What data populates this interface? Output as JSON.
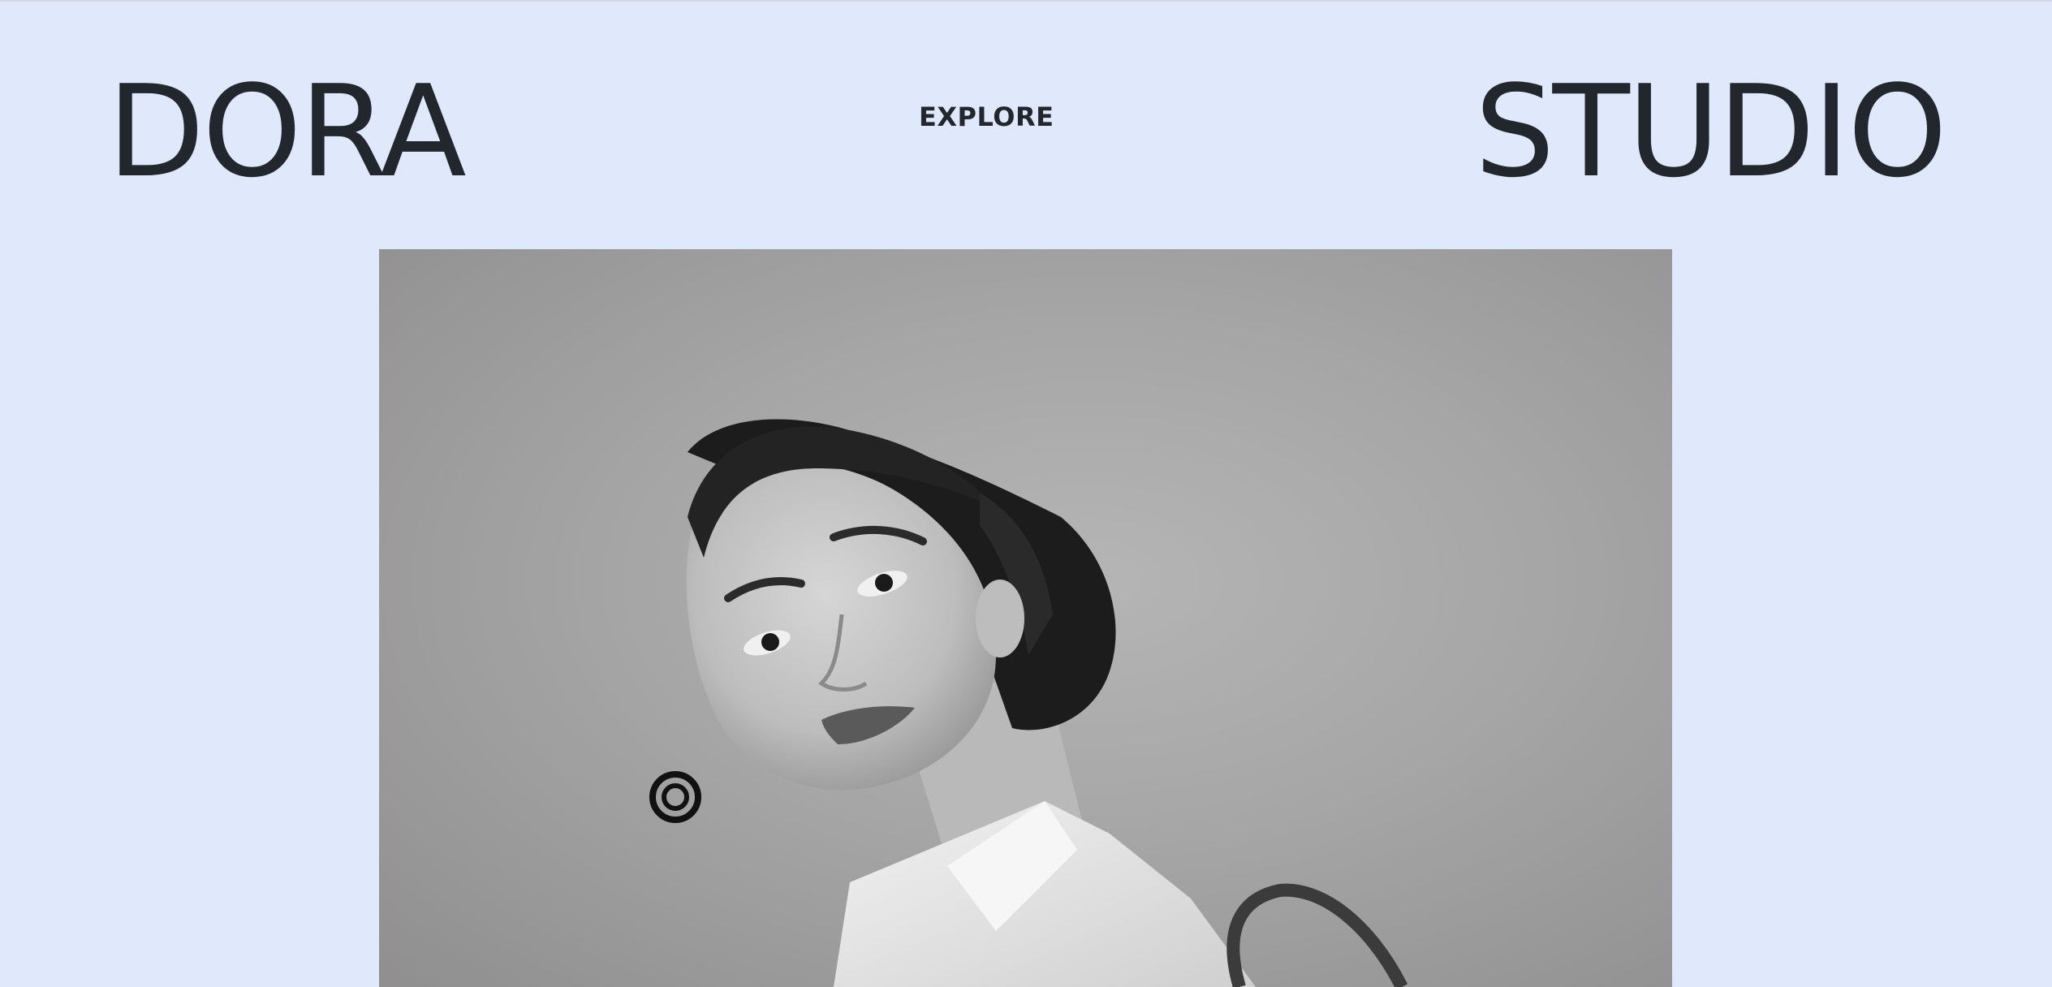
{
  "header": {
    "brand_left": "DORA",
    "nav_link": "EXPLORE",
    "brand_right": "STUDIO"
  },
  "hero": {
    "image_kind": "black-and-white portrait photograph"
  },
  "colors": {
    "background": "#e0e9fb",
    "text": "#22262d",
    "photo_grey": "#a6a6a6"
  }
}
